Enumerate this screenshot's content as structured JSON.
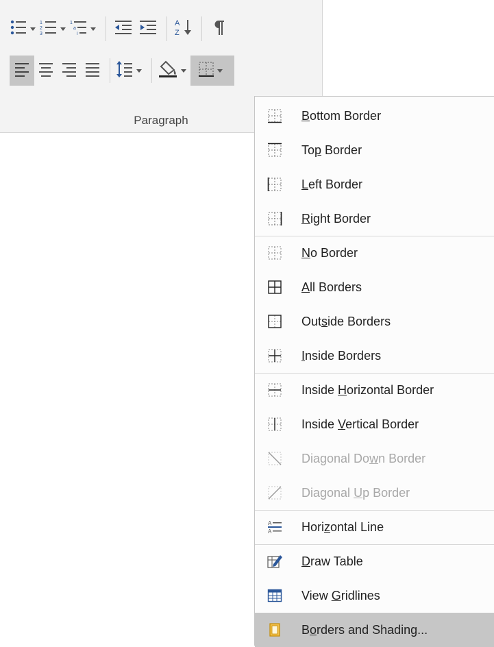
{
  "group": {
    "label": "Paragraph"
  },
  "menu": {
    "items": [
      {
        "pre": "",
        "key": "B",
        "post": "ottom Border",
        "icon": "bottom-border-icon"
      },
      {
        "pre": "To",
        "key": "p",
        "post": " Border",
        "icon": "top-border-icon"
      },
      {
        "pre": "",
        "key": "L",
        "post": "eft Border",
        "icon": "left-border-icon"
      },
      {
        "pre": "",
        "key": "R",
        "post": "ight Border",
        "icon": "right-border-icon"
      },
      {
        "pre": "",
        "key": "N",
        "post": "o Border",
        "icon": "no-border-icon"
      },
      {
        "pre": "",
        "key": "A",
        "post": "ll Borders",
        "icon": "all-borders-icon"
      },
      {
        "pre": "Out",
        "key": "s",
        "post": "ide Borders",
        "icon": "outside-borders-icon"
      },
      {
        "pre": "",
        "key": "I",
        "post": "nside Borders",
        "icon": "inside-borders-icon"
      },
      {
        "pre": "Inside ",
        "key": "H",
        "post": "orizontal Border",
        "icon": "inside-horizontal-border-icon"
      },
      {
        "pre": "Inside ",
        "key": "V",
        "post": "ertical Border",
        "icon": "inside-vertical-border-icon"
      },
      {
        "pre": "Diagonal Do",
        "key": "w",
        "post": "n Border",
        "icon": "diagonal-down-border-icon"
      },
      {
        "pre": "Diagonal ",
        "key": "U",
        "post": "p Border",
        "icon": "diagonal-up-border-icon"
      },
      {
        "pre": "Hori",
        "key": "z",
        "post": "ontal Line",
        "icon": "horizontal-line-icon"
      },
      {
        "pre": "",
        "key": "D",
        "post": "raw Table",
        "icon": "draw-table-icon"
      },
      {
        "pre": "View ",
        "key": "G",
        "post": "ridlines",
        "icon": "view-gridlines-icon"
      },
      {
        "pre": "B",
        "key": "o",
        "post": "rders and Shading...",
        "icon": "borders-and-shading-icon"
      }
    ]
  },
  "colors": {
    "ribbon_bg": "#f3f3f3",
    "menu_bg": "#fcfcfc",
    "highlight": "#c6c6c6",
    "accent_blue": "#2b579a",
    "disabled_text": "#a8a8a8"
  }
}
